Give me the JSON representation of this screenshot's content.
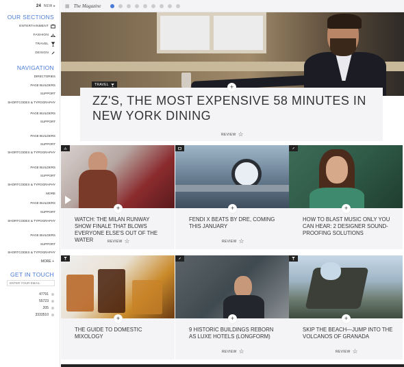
{
  "sidebar": {
    "news_count": "24",
    "news_label": "NEW",
    "sections_title": "OUR SECTIONS",
    "sections": [
      {
        "label": "ENTERTAINMENT",
        "icon": "tv-icon",
        "color": "#4a7bd6"
      },
      {
        "label": "FASHION",
        "icon": "hanger-icon",
        "color": "#e05a5a"
      },
      {
        "label": "TRAVEL",
        "icon": "drink-icon",
        "color": "#5aa05a"
      },
      {
        "label": "DESIGN",
        "icon": "pencil-icon",
        "color": "#333333"
      }
    ],
    "navigation_title": "NAVIGATION",
    "nav_items": [
      "DIRECTORIES",
      "PAGE BUILDERS",
      "SUPPORT",
      "SHORTCODES & TYPOGRAPHY",
      "PAGE BUILDERS",
      "SUPPORT",
      "PAGE BUILDERS",
      "SUPPORT",
      "SHORTCODES & TYPOGRAPHY",
      "PAGE BUILDERS",
      "SUPPORT",
      "SHORTCODES & TYPOGRAPHY",
      "MORE",
      "PAGE BUILDERS",
      "SUPPORT",
      "SHORTCODES & TYPOGRAPHY",
      "PAGE BUILDERS",
      "SUPPORT",
      "SHORTCODES & TYPOGRAPHY"
    ],
    "more_label": "MORE +",
    "get_in_touch_title": "GET IN TOUCH",
    "email_placeholder": "ENTER YOUR EMAIL",
    "counters": [
      "47791",
      "55723",
      "205",
      "3333510"
    ]
  },
  "topbar": {
    "logo": "The Magazine",
    "accent": "#4a7bd6"
  },
  "hero": {
    "badge": "TRAVEL",
    "title": "ZZ'S, THE MOST EXPENSIVE 58 MINUTES IN NEW YORK DINING",
    "review_label": "REVIEW"
  },
  "cards": [
    {
      "title": "WATCH: THE MILAN RUNWAY SHOW FINALE THAT BLOWS EVERYONE ELSE'S OUT OF THE WATER",
      "review": "REVIEW",
      "icon": "hanger-icon"
    },
    {
      "title": "FENDI X BEATS BY DRE, COMING THIS JANUARY",
      "review": "REVIEW",
      "icon": "tv-icon"
    },
    {
      "title": "HOW TO BLAST MUSIC ONLY YOU CAN HEAR: 2 DESIGNER SOUND-PROOFING SOLUTIONS",
      "review": "REVIEW",
      "icon": "pencil-icon"
    },
    {
      "title": "THE GUIDE TO DOMESTIC MIXOLOGY",
      "review": "",
      "icon": "drink-icon"
    },
    {
      "title": "9 HISTORIC BUILDINGS REBORN AS LUXE HOTELS (LONGFORM)",
      "review": "REVIEW",
      "icon": "pencil-icon"
    },
    {
      "title": "SKIP THE BEACH—JUMP INTO THE VOLCANOS OF GRANADA",
      "review": "REVIEW",
      "icon": "drink-icon"
    }
  ]
}
